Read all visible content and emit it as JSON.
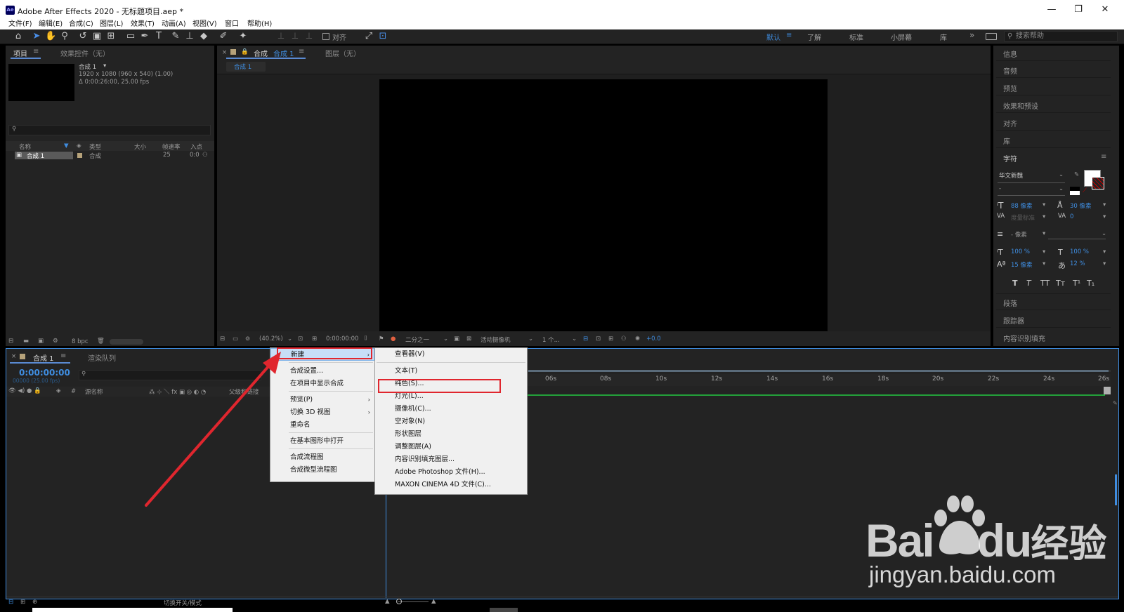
{
  "window": {
    "app_logo": "Ae",
    "title": "Adobe After Effects 2020 - 无标题项目.aep *",
    "minimize": "—",
    "restore": "❐",
    "close": "✕"
  },
  "menu": [
    "文件(F)",
    "编辑(E)",
    "合成(C)",
    "图层(L)",
    "效果(T)",
    "动画(A)",
    "视图(V)",
    "窗口",
    "帮助(H)"
  ],
  "toolbar": {
    "align_label": "对齐",
    "workspaces": [
      "默认",
      "了解",
      "标准",
      "小屏幕",
      "库"
    ],
    "more": "»",
    "search_placeholder": "搜索帮助"
  },
  "project_panel": {
    "tab_project": "项目",
    "tab_effects": "效果控件（无）",
    "comp_name": "合成 1",
    "comp_info1": "1920 x 1080  (960 x 540) (1.00)",
    "comp_info2": "Δ 0:00:26:00, 25.00 fps",
    "columns": [
      "名称",
      "类型",
      "大小",
      "帧速率",
      "入点"
    ],
    "row": {
      "name": "合成 1",
      "type": "合成",
      "fps": "25",
      "in": "0:0"
    },
    "bpc": "8 bpc"
  },
  "comp_panel": {
    "tab_label": "合成",
    "tab_name": "合成 1",
    "layer_tab": "图层（无）",
    "breadcrumb": "合成 1",
    "zoom": "(40.2%)",
    "timecode": "0:00:00:00",
    "resolution": "二分之一",
    "camera": "活动摄像机",
    "views": "1 个...",
    "exposure": "+0.0"
  },
  "timeline": {
    "tab_name": "合成 1",
    "render_queue": "渲染队列",
    "timecode": "0:00:00:00",
    "frame_info": "00000 (25.00 fps)",
    "col_source": "源名称",
    "col_parent": "父级和链接",
    "col_hash": "#",
    "switch_mode": "切换开关/模式",
    "ruler": [
      "06s",
      "08s",
      "10s",
      "12s",
      "14s",
      "16s",
      "18s",
      "20s",
      "22s",
      "24s",
      "26s"
    ]
  },
  "context_menu": {
    "main": [
      "新建",
      "合成设置...",
      "在项目中显示合成",
      "预览(P)",
      "切换 3D 视图",
      "重命名",
      "在基本图形中打开",
      "合成流程图",
      "合成微型流程图"
    ],
    "submenu": [
      "查看器(V)",
      "文本(T)",
      "纯色(S)...",
      "灯光(L)...",
      "摄像机(C)...",
      "空对象(N)",
      "形状图层",
      "调整图层(A)",
      "内容识别填充图层...",
      "Adobe Photoshop 文件(H)...",
      "MAXON CINEMA 4D 文件(C)..."
    ],
    "highlighted": "纯色(S)..."
  },
  "right_panel": {
    "sections": [
      "信息",
      "音频",
      "预览",
      "效果和预设",
      "对齐",
      "库"
    ],
    "character": "字符",
    "font": "华文新魏",
    "font_style": "-",
    "font_size": "88 像素",
    "leading": "30 像素",
    "kerning": "度量标准",
    "tracking": "0",
    "stroke_width": "- 像素",
    "vscale": "100 %",
    "hscale": "100 %",
    "baseline": "15 像素",
    "tsume": "12 %",
    "typo_buttons": [
      "T",
      "T",
      "TT",
      "Tт",
      "T¹",
      "T₁"
    ],
    "paragraph": "段落",
    "tracker": "跟踪器",
    "content_fill": "内容识别填充"
  },
  "watermark": {
    "brand": "Bai",
    "brand2": "du",
    "brand_cn": "经验",
    "url": "jingyan.baidu.com"
  },
  "colors": {
    "accent": "#3f8de0",
    "annotation": "#e0262e",
    "panel": "#232323",
    "bg": "#1d1d1d"
  }
}
